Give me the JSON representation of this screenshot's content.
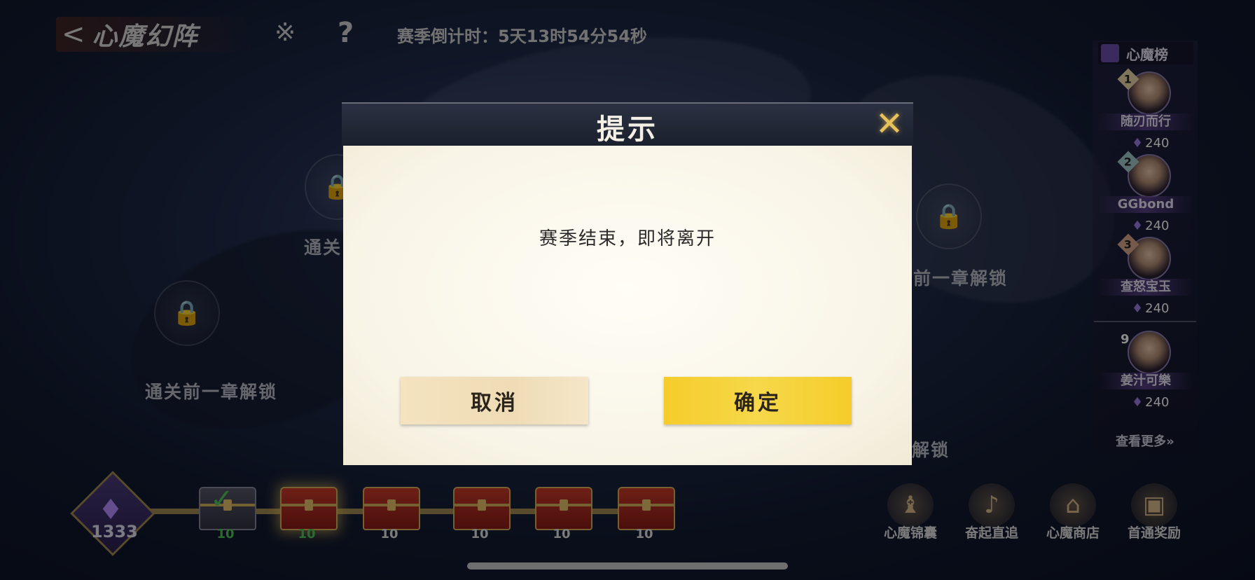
{
  "header": {
    "back_glyph": "<",
    "title": "心魔幻阵",
    "rule_icon_glyph": "※",
    "help_icon_glyph": "?",
    "countdown": "赛季倒计时：5天13时54分54秒"
  },
  "map": {
    "labels": [
      "通关",
      "通关前一章解锁",
      "前一章解锁",
      "解锁"
    ]
  },
  "ranking": {
    "title": "心魔榜",
    "entries": [
      {
        "rank": "1",
        "name": "随刃而行",
        "score": "240"
      },
      {
        "rank": "2",
        "name": "GGbond",
        "score": "240"
      },
      {
        "rank": "3",
        "name": "查怒宝玉",
        "score": "240"
      },
      {
        "rank": "9",
        "name": "姜汁可樂",
        "score": "240"
      }
    ],
    "view_more": "查看更多»"
  },
  "progress": {
    "total": "1333",
    "chests": [
      {
        "count": "10",
        "state": "claimed"
      },
      {
        "count": "10",
        "state": "available"
      },
      {
        "count": "10",
        "state": "locked"
      },
      {
        "count": "10",
        "state": "locked"
      },
      {
        "count": "10",
        "state": "locked"
      },
      {
        "count": "10",
        "state": "locked"
      }
    ]
  },
  "functions": [
    {
      "label": "心魔锦囊",
      "icon": "pouch-icon"
    },
    {
      "label": "奋起直追",
      "icon": "horn-icon"
    },
    {
      "label": "心魔商店",
      "icon": "shop-icon"
    },
    {
      "label": "首通奖励",
      "icon": "reward-chest-icon"
    }
  ],
  "dialog": {
    "title": "提示",
    "close_glyph": "✕",
    "message": "赛季结束，即将离开",
    "cancel_label": "取消",
    "confirm_label": "确定"
  },
  "colors": {
    "confirm_button": "#f5cc2a",
    "cancel_button": "#f4e3bf",
    "close_accent": "#e7c15a"
  }
}
